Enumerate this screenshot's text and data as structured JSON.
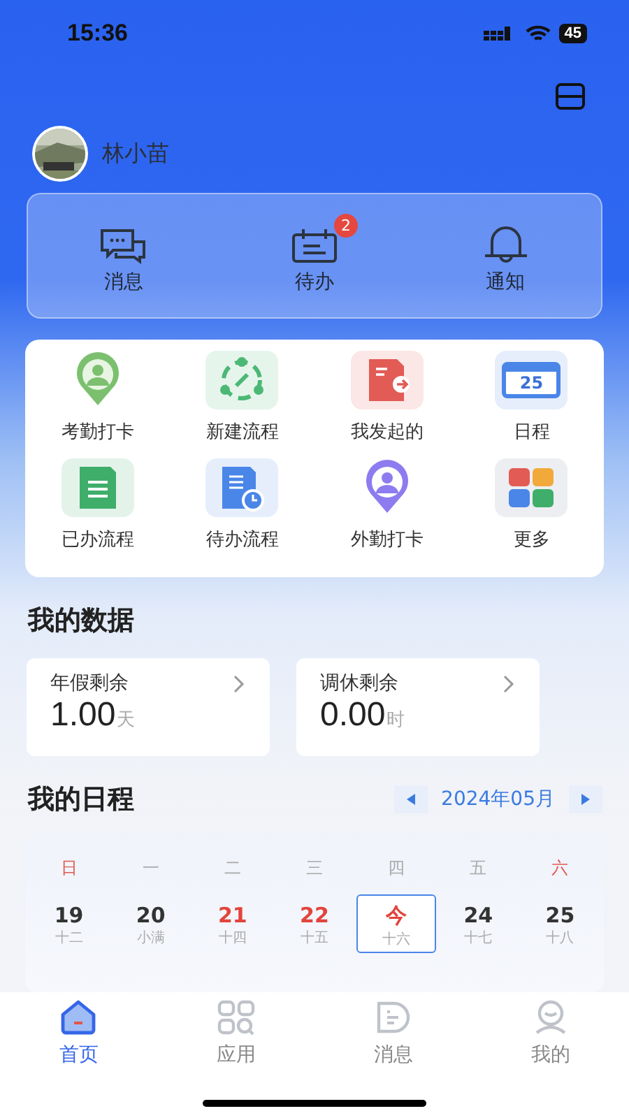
{
  "status_bar": {
    "time": "15:36",
    "battery": "45"
  },
  "user": {
    "name": "林小苗"
  },
  "quick_actions": [
    {
      "kind": "message",
      "label": "消息"
    },
    {
      "kind": "todo",
      "label": "待办",
      "badge": "2"
    },
    {
      "kind": "bell",
      "label": "通知"
    }
  ],
  "apps": [
    {
      "kind": "checkin",
      "label": "考勤打卡"
    },
    {
      "kind": "newflow",
      "label": "新建流程"
    },
    {
      "kind": "mine",
      "label": "我发起的"
    },
    {
      "kind": "calendar",
      "label": "日程",
      "icon_text": "25"
    },
    {
      "kind": "done",
      "label": "已办流程"
    },
    {
      "kind": "pending",
      "label": "待办流程"
    },
    {
      "kind": "outside",
      "label": "外勤打卡"
    },
    {
      "kind": "more",
      "label": "更多"
    }
  ],
  "my_data": {
    "title": "我的数据",
    "cards": [
      {
        "label": "年假剩余",
        "value": "1.00",
        "unit": "天"
      },
      {
        "label": "调休剩余",
        "value": "0.00",
        "unit": "时"
      }
    ]
  },
  "schedule": {
    "title": "我的日程",
    "month": "2024年05月",
    "weekdays": [
      {
        "label": "日",
        "holiday": true
      },
      {
        "label": "一",
        "holiday": false
      },
      {
        "label": "二",
        "holiday": false
      },
      {
        "label": "三",
        "holiday": false
      },
      {
        "label": "四",
        "holiday": false
      },
      {
        "label": "五",
        "holiday": false
      },
      {
        "label": "六",
        "holiday": true
      }
    ],
    "days": [
      {
        "day": "19",
        "lunar": "十二",
        "holiday": false,
        "selected": false
      },
      {
        "day": "20",
        "lunar": "小满",
        "holiday": false,
        "selected": false
      },
      {
        "day": "21",
        "lunar": "十四",
        "holiday": true,
        "selected": false
      },
      {
        "day": "22",
        "lunar": "十五",
        "holiday": true,
        "selected": false
      },
      {
        "day": "今",
        "lunar": "十六",
        "holiday": true,
        "selected": true
      },
      {
        "day": "24",
        "lunar": "十七",
        "holiday": false,
        "selected": false
      },
      {
        "day": "25",
        "lunar": "十八",
        "holiday": false,
        "selected": false
      }
    ]
  },
  "tab_bar": [
    {
      "kind": "home",
      "label": "首页",
      "selected": true
    },
    {
      "kind": "apps",
      "label": "应用",
      "selected": false
    },
    {
      "kind": "chat",
      "label": "消息",
      "selected": false
    },
    {
      "kind": "profile",
      "label": "我的",
      "selected": false
    }
  ]
}
